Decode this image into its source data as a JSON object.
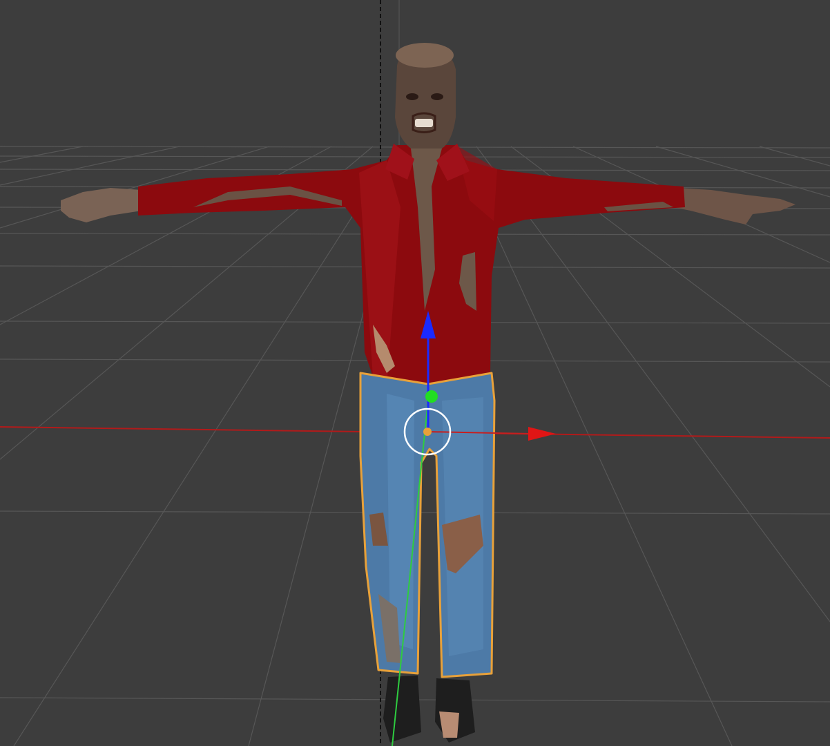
{
  "viewport": {
    "background": "#3d3d3d",
    "grid_color": "#555555",
    "x_axis_color": "#c81e1e",
    "y_axis_color": "#33cc33",
    "z_gizmo_color": "#1a2aff",
    "selection_outline_color": "#e8a13a",
    "shirt_color": "#8e0a0f",
    "jeans_color": "#4a78a8",
    "skin_color": "#6b5446"
  },
  "scene": {
    "object": "zombie-character-mesh",
    "pose": "T-pose",
    "selected_part": "jeans",
    "transform_gizmo": "translate",
    "icons": [
      "move-gizmo-icon",
      "pivot-icon",
      "camera-clip-line"
    ]
  }
}
